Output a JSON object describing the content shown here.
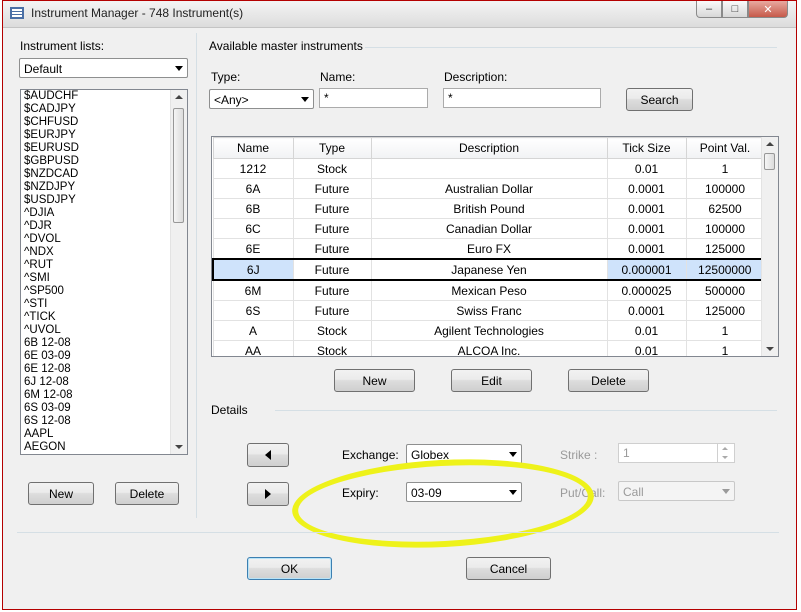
{
  "window": {
    "title": "Instrument Manager - 748 Instrument(s)"
  },
  "instrument_lists": {
    "label": "Instrument lists:",
    "selected": "Default",
    "items": [
      "$AUDCHF",
      "$CADJPY",
      "$CHFUSD",
      "$EURJPY",
      "$EURUSD",
      "$GBPUSD",
      "$NZDCAD",
      "$NZDJPY",
      "$USDJPY",
      "^DJIA",
      "^DJR",
      "^DVOL",
      "^NDX",
      "^RUT",
      "^SMI",
      "^SP500",
      "^STI",
      "^TICK",
      "^UVOL",
      "6B 12-08",
      "6E 03-09",
      "6E 12-08",
      "6J 12-08",
      "6M 12-08",
      "6S 03-09",
      "6S 12-08",
      "AAPL",
      "AEGON"
    ],
    "new_label": "New",
    "delete_label": "Delete"
  },
  "master": {
    "group_label": "Available master instruments",
    "type_label": "Type:",
    "type_value": "<Any>",
    "name_label": "Name:",
    "name_value": "*",
    "description_label": "Description:",
    "description_value": "*",
    "search_label": "Search",
    "columns": [
      "Name",
      "Type",
      "Description",
      "Tick Size",
      "Point Val."
    ],
    "rows": [
      [
        "1212",
        "Stock",
        "",
        "0.01",
        "1"
      ],
      [
        "6A",
        "Future",
        "Australian Dollar",
        "0.0001",
        "100000"
      ],
      [
        "6B",
        "Future",
        "British Pound",
        "0.0001",
        "62500"
      ],
      [
        "6C",
        "Future",
        "Canadian Dollar",
        "0.0001",
        "100000"
      ],
      [
        "6E",
        "Future",
        "Euro FX",
        "0.0001",
        "125000"
      ],
      [
        "6J",
        "Future",
        "Japanese Yen",
        "0.000001",
        "12500000"
      ],
      [
        "6M",
        "Future",
        "Mexican Peso",
        "0.000025",
        "500000"
      ],
      [
        "6S",
        "Future",
        "Swiss Franc",
        "0.0001",
        "125000"
      ],
      [
        "A",
        "Stock",
        "Agilent Technologies",
        "0.01",
        "1"
      ],
      [
        "AA",
        "Stock",
        "ALCOA Inc.",
        "0.01",
        "1"
      ]
    ],
    "selected_row": 5,
    "new_label": "New",
    "edit_label": "Edit",
    "delete_label": "Delete"
  },
  "details": {
    "group_label": "Details",
    "exchange_label": "Exchange:",
    "exchange_value": "Globex",
    "expiry_label": "Expiry:",
    "expiry_value": "03-09",
    "strike_label": "Strike :",
    "strike_value": "1",
    "putcall_label": "Put/Call:",
    "putcall_value": "Call"
  },
  "footer": {
    "ok_label": "OK",
    "cancel_label": "Cancel"
  },
  "colors": {
    "highlight": "#eef21a",
    "selection": "#cfe3fb",
    "window_border": "#b40000"
  }
}
